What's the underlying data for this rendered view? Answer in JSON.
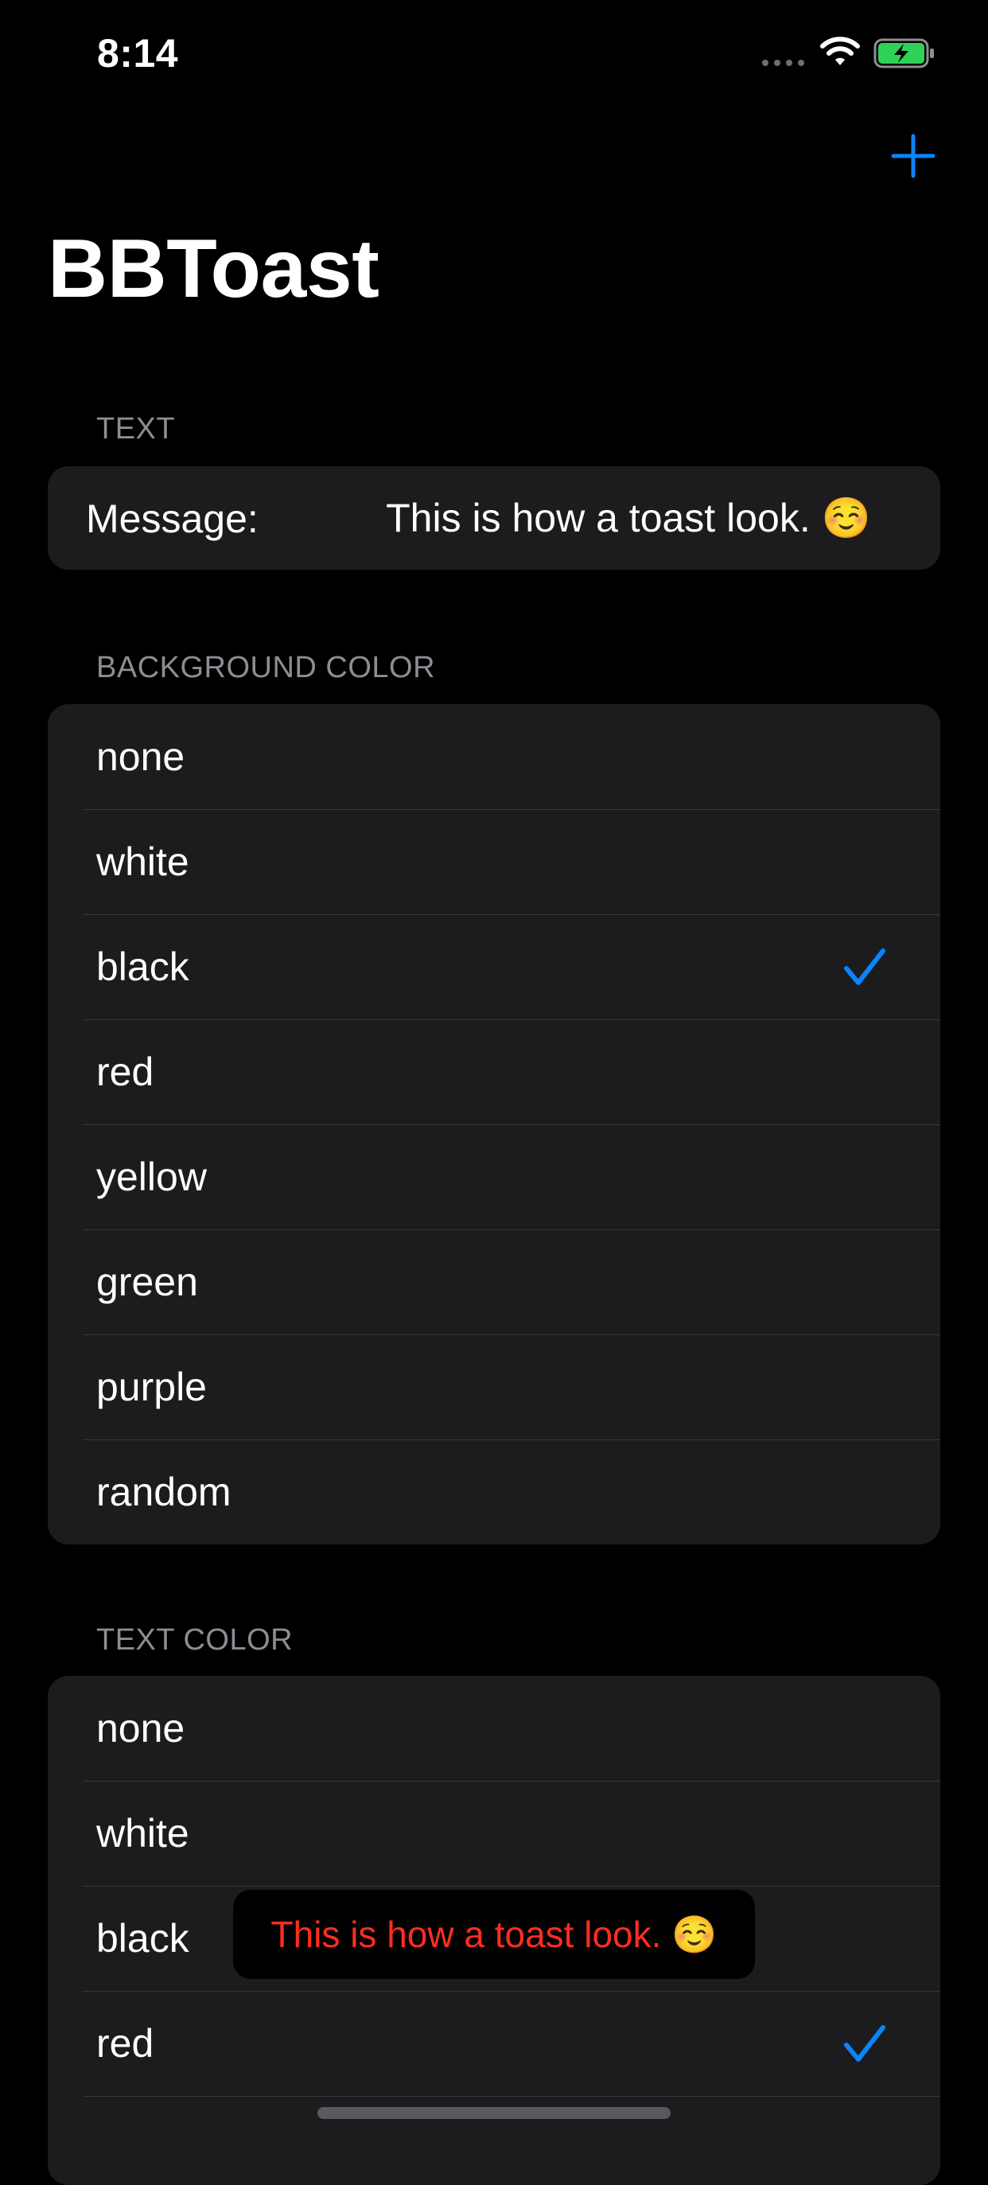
{
  "status_bar": {
    "time": "8:14",
    "icons": [
      "cellular-signal-icon",
      "wifi-icon",
      "battery-charging-icon"
    ]
  },
  "nav": {
    "title": "BBToast",
    "add_icon": "plus-icon"
  },
  "sections": {
    "text": {
      "header": "TEXT",
      "message_label": "Message:",
      "message_value": "This is how a toast look. ☺️"
    },
    "background_color": {
      "header": "BACKGROUND COLOR",
      "options": [
        "none",
        "white",
        "black",
        "red",
        "yellow",
        "green",
        "purple",
        "random"
      ],
      "selected": "black"
    },
    "text_color": {
      "header": "TEXT COLOR",
      "options": [
        "none",
        "white",
        "black",
        "red"
      ],
      "selected": "red"
    }
  },
  "toast": {
    "message": "This is how a toast look. ☺️",
    "text_color": "#ff2d20",
    "background_color": "#000000"
  },
  "colors": {
    "accent": "#0a84ff",
    "background": "#000000",
    "cell_background": "#1c1c1e",
    "secondary_text": "#8d8d93",
    "separator": "#38383a",
    "battery_green": "#30d158"
  }
}
